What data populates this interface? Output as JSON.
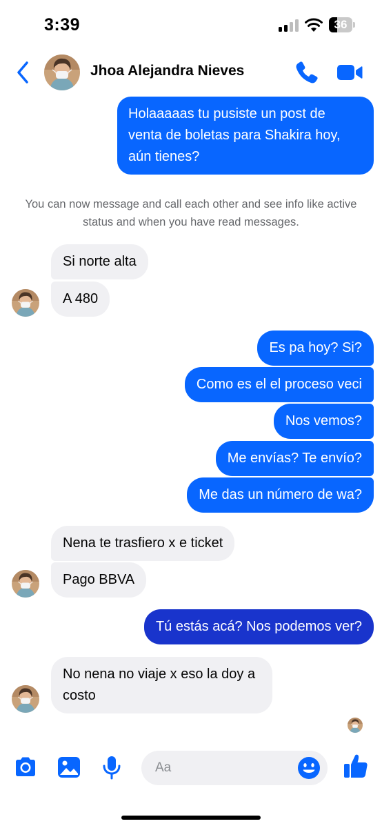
{
  "status_bar": {
    "time": "3:39",
    "battery_level": "36",
    "battery_fraction": 0.36,
    "signal_bars_active": 2,
    "signal_bars_total": 4
  },
  "header": {
    "contact_name": "Jhoa Alejandra Nieves",
    "back_icon": "chevron-left-icon",
    "call_icon": "phone-icon",
    "video_icon": "video-camera-icon",
    "accent_color": "#0866ff"
  },
  "messages": [
    {
      "from": "me",
      "text": "Holaaaaas tu pusiste un post de venta de boletas para Shakira hoy, aún tienes?"
    },
    {
      "from": "system",
      "text": "You can now message and call each other and see info like active status and when you have read messages."
    },
    {
      "from": "them",
      "text": "Si norte alta"
    },
    {
      "from": "them",
      "text": "A 480"
    },
    {
      "from": "me",
      "text": "Es pa hoy? Si?"
    },
    {
      "from": "me",
      "text": "Como es el el proceso veci"
    },
    {
      "from": "me",
      "text": "Nos vemos?"
    },
    {
      "from": "me",
      "text": "Me envías? Te envío?"
    },
    {
      "from": "me",
      "text": "Me das un número de wa?"
    },
    {
      "from": "them",
      "text": "Nena te trasfiero x e ticket"
    },
    {
      "from": "them",
      "text": "Pago BBVA"
    },
    {
      "from": "me",
      "text": "Tú estás acá? Nos podemos ver?"
    },
    {
      "from": "them",
      "text": "No nena no viaje x eso la doy a costo"
    }
  ],
  "composer": {
    "placeholder": "Aa",
    "camera_icon": "camera-icon",
    "gallery_icon": "image-icon",
    "mic_icon": "microphone-icon",
    "emoji_icon": "smiley-icon",
    "like_icon": "thumbs-up-icon"
  },
  "colors": {
    "outgoing_bubble": "#0866ff",
    "outgoing_bubble_deep": "#1934cc",
    "incoming_bubble": "#f0f0f3",
    "system_text": "#65676b"
  }
}
